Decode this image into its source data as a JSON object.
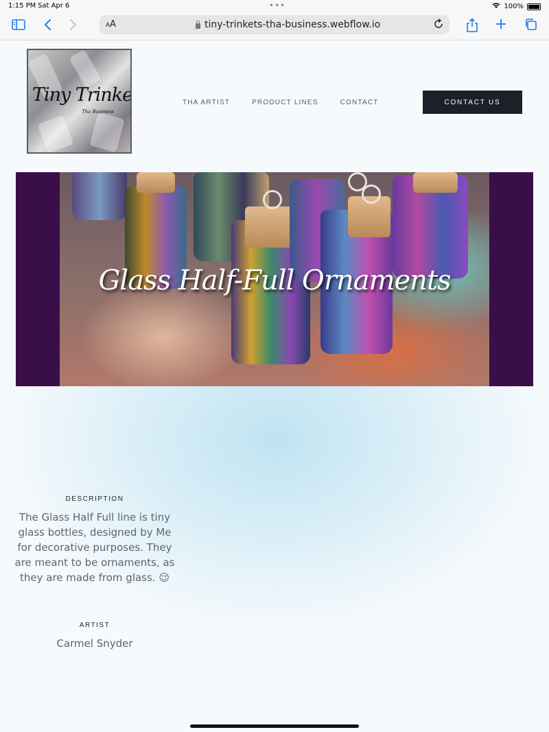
{
  "status_bar": {
    "time": "1:15 PM",
    "date": "Sat Apr 6",
    "battery": "100%"
  },
  "browser": {
    "text_size_button": "AA",
    "url": "tiny-trinkets-tha-business.webflow.io",
    "icons": [
      "sidebar-icon",
      "back-icon",
      "forward-icon",
      "lock-icon",
      "reload-icon",
      "share-icon",
      "new-tab-icon",
      "tabs-icon"
    ]
  },
  "site": {
    "logo": {
      "title": "Tiny Trinkets",
      "subtitle": "Tha Business"
    },
    "nav": {
      "artist": "THA ARTIST",
      "product_lines": "PRODUCT LINES",
      "contact": "CONTACT"
    },
    "cta": "CONTACT US"
  },
  "hero": {
    "headline": "Glass Half-Full Ornaments"
  },
  "details": {
    "description_label": "DESCRIPTION",
    "description_text": "The Glass Half Full line is tiny glass bottles, designed by Me for decorative purposes.  They are meant to be ornaments, as they are made from glass. 😉",
    "artist_label": "ARTIST",
    "artist_name": "Carmel Snyder"
  },
  "colors": {
    "accent": "#1a7cf0",
    "cta_bg": "#1c2129",
    "hero_side": "#3a0e48"
  }
}
